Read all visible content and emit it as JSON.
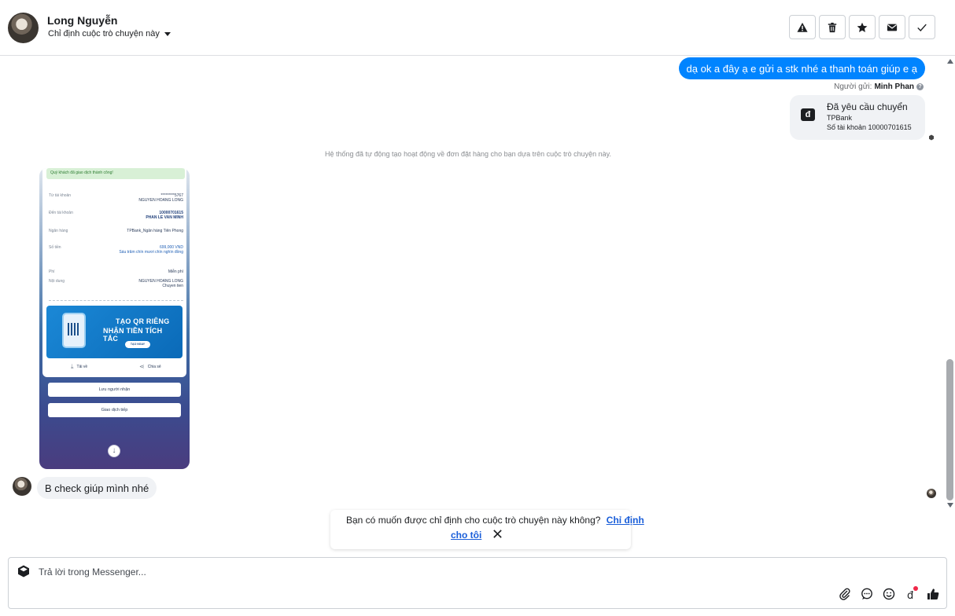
{
  "header": {
    "contact_name": "Long Nguyễn",
    "assign_label": "Chỉ định cuộc trò chuyện này",
    "toolbar": [
      "warning-icon",
      "trash-icon",
      "star-icon",
      "envelope-icon",
      "check-icon"
    ]
  },
  "conversation": {
    "outgoing_message": "dạ ok a đây ạ e gửi a stk nhé a thanh toán giúp e ạ",
    "sender_prefix": "Người gửi:",
    "sender_name": "Minh Phan",
    "help_glyph": "?",
    "payment_request": {
      "icon_glyph": "đ",
      "title": "Đã yêu cầu chuyển",
      "bank": "TPBank",
      "account": "Số tài khoản 10000701615"
    },
    "system_note": "Hệ thống đã tự động tạo hoạt động về đơn đặt hàng cho bạn dựa trên cuộc trò chuyện này.",
    "receipt": {
      "banner": "Quý khách đã giao dịch thành công!",
      "rows": [
        {
          "label": "Từ tài khoản",
          "value": "*********5767\nNGUYEN HOANG LONG"
        },
        {
          "label": "Đến tài khoản",
          "value": "10000701615\nPHAN LE VAN MINH"
        },
        {
          "label": "Ngân hàng",
          "value": "TPBank_Ngân hàng Tiên Phong"
        },
        {
          "label": "Số tiền",
          "value": "699,000 VND\nSáu trăm chín mươi chín nghìn đồng"
        },
        {
          "label": "Phí",
          "value": "Miễn phí"
        },
        {
          "label": "Nội dung",
          "value": "NGUYEN HOANG LONG\nChuyen tien"
        }
      ],
      "ad_title1": "TẠO QR RIÊNG",
      "ad_title2": "NHẬN TIỀN TÍCH TẮC",
      "ad_button": "TẠO NGAY",
      "action_download": "Tải về",
      "action_share": "Chia sẻ",
      "save_recipient": "Lưu người nhận",
      "continue": "Giao dịch tiếp",
      "down_glyph": "↓"
    },
    "incoming_message": "B check giúp mình nhé"
  },
  "assign_prompt": {
    "question": "Bạn có muốn được chỉ định cho cuộc trò chuyện này không?",
    "link_part1": "Chỉ định",
    "link_part2": "cho tôi"
  },
  "composer": {
    "placeholder": "Trả lời trong Messenger...",
    "tools": [
      "paperclip-icon",
      "chat-bubble-icon",
      "smiley-icon",
      "dong-icon",
      "thumbs-up-icon"
    ],
    "accent": "#0084ff"
  }
}
